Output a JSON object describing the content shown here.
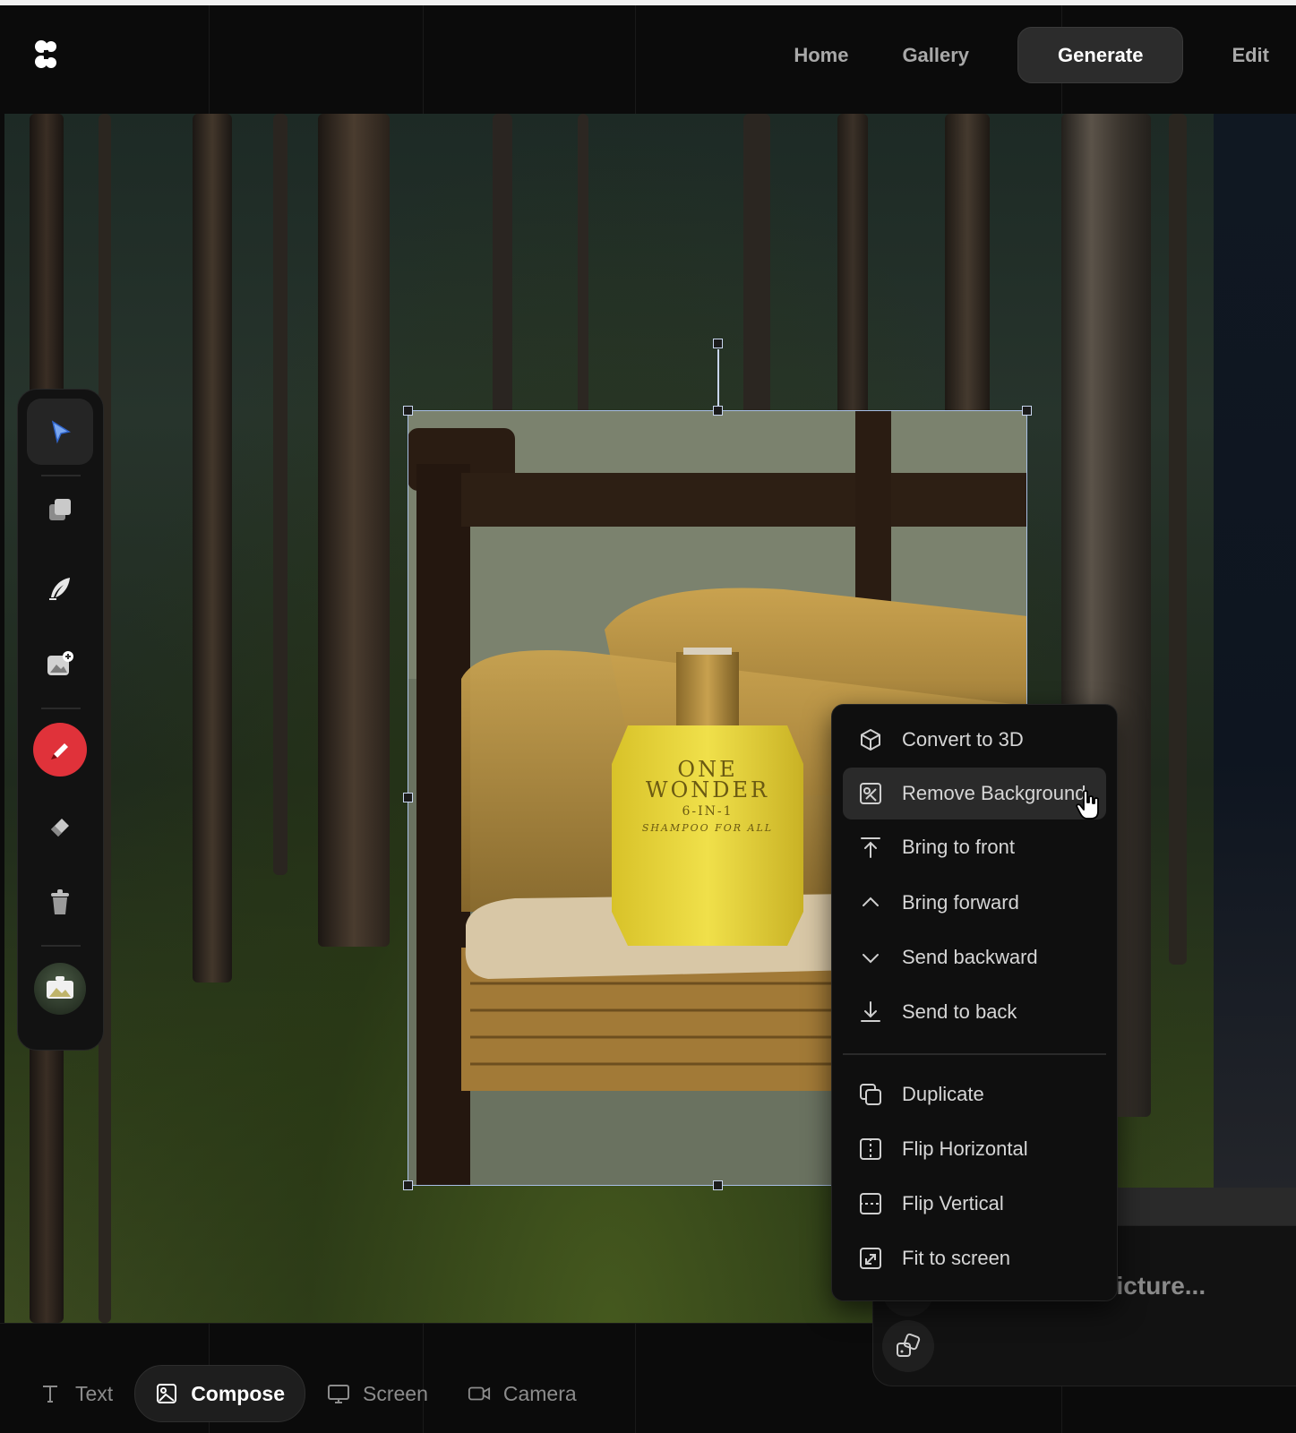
{
  "app": {
    "logo": "app-logo"
  },
  "nav": {
    "items": [
      {
        "label": "Home",
        "active": false
      },
      {
        "label": "Gallery",
        "active": false
      },
      {
        "label": "Generate",
        "active": true
      },
      {
        "label": "Edit",
        "active": false
      }
    ]
  },
  "toolbar": {
    "tools": [
      {
        "icon": "cursor-arrow-icon",
        "active": true
      },
      {
        "icon": "layers-icon"
      },
      {
        "icon": "feather-pen-icon"
      },
      {
        "icon": "add-image-icon"
      },
      {
        "icon": "marker-icon",
        "accent": "#e0323a"
      },
      {
        "icon": "eraser-icon"
      },
      {
        "icon": "trash-icon"
      },
      {
        "icon": "image-preview-icon"
      }
    ]
  },
  "product": {
    "brand_line1": "ONE",
    "brand_line2": "WONDER",
    "subtitle": "6-IN-1",
    "tagline": "SHAMPOO FOR ALL"
  },
  "context_menu": {
    "items": [
      {
        "label": "Convert to 3D",
        "icon": "cube-icon"
      },
      {
        "label": "Remove Background",
        "icon": "remove-background-icon",
        "hovered": true
      },
      {
        "label": "Bring to front",
        "icon": "bring-to-front-icon"
      },
      {
        "label": "Bring forward",
        "icon": "chevron-up-icon"
      },
      {
        "label": "Send backward",
        "icon": "chevron-down-icon"
      },
      {
        "label": "Send to back",
        "icon": "send-to-back-icon"
      },
      {
        "label": "Duplicate",
        "icon": "duplicate-icon"
      },
      {
        "label": "Flip Horizontal",
        "icon": "flip-horizontal-icon"
      },
      {
        "label": "Flip Vertical",
        "icon": "flip-vertical-icon"
      },
      {
        "label": "Fit to screen",
        "icon": "fit-to-screen-icon"
      }
    ]
  },
  "prompt": {
    "placeholder": "Describe a picture..."
  },
  "bottom_tabs": [
    {
      "label": "Text",
      "icon": "text-icon"
    },
    {
      "label": "Compose",
      "icon": "image-icon",
      "active": true
    },
    {
      "label": "Screen",
      "icon": "monitor-icon"
    },
    {
      "label": "Camera",
      "icon": "video-camera-icon"
    }
  ],
  "colors": {
    "background": "#0b0b0b",
    "selection": "#a8bfe6",
    "accent_red": "#e0323a",
    "product_yellow": "#e6d235"
  }
}
